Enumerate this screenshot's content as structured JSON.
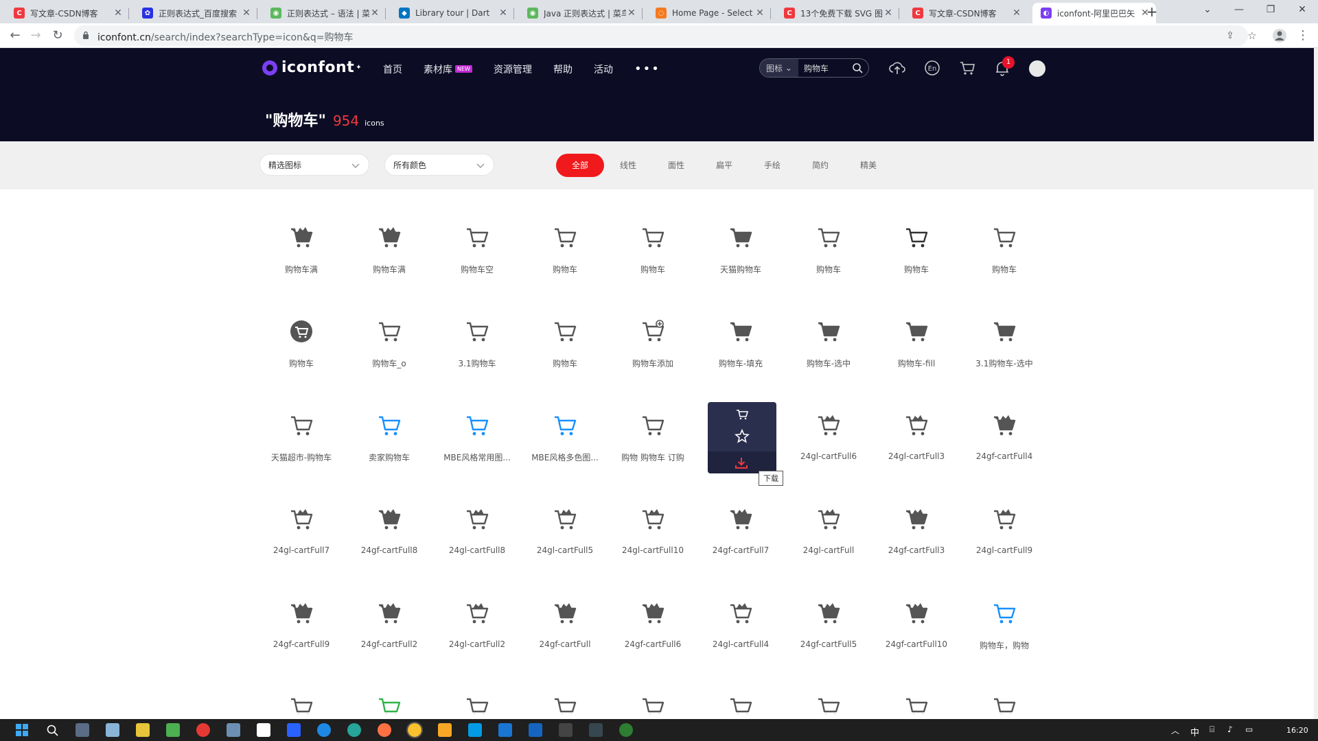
{
  "browser": {
    "tabs": [
      {
        "title": "写文章-CSDN博客",
        "color": "#f0383f",
        "glyph": "C"
      },
      {
        "title": "正则表达式_百度搜索",
        "color": "#2932e1",
        "glyph": "✿"
      },
      {
        "title": "正则表达式 – 语法 | 菜",
        "color": "#5cb85c",
        "glyph": "◉"
      },
      {
        "title": "Library tour | Dart",
        "color": "#0175c2",
        "glyph": "◆"
      },
      {
        "title": "Java 正则表达式 | 菜鸟",
        "color": "#5cb85c",
        "glyph": "◉"
      },
      {
        "title": "Home Page - Select",
        "color": "#f47a20",
        "glyph": "◌"
      },
      {
        "title": "13个免费下载 SVG 图",
        "color": "#f0383f",
        "glyph": "C"
      },
      {
        "title": "写文章-CSDN博客",
        "color": "#f0383f",
        "glyph": "C"
      },
      {
        "title": "iconfont-阿里巴巴矢",
        "color": "#7b3ff2",
        "glyph": "◐"
      }
    ],
    "url_host": "iconfont.cn",
    "url_path": "/search/index?searchType=icon&q=购物车"
  },
  "header": {
    "logo": "iconfont",
    "nav": [
      "首页",
      "素材库",
      "资源管理",
      "帮助",
      "活动"
    ],
    "new_badge": "NEW",
    "more": "•••",
    "search_type": "图标",
    "search_query": "购物车",
    "notif_count": "1",
    "result_query": "\"购物车\"",
    "result_count": "954",
    "result_unit": "icons"
  },
  "filters": {
    "select1": "精选图标",
    "select2": "所有颜色",
    "style_tabs": [
      "全部",
      "线性",
      "面性",
      "扁平",
      "手绘",
      "简约",
      "精美"
    ],
    "active_tab": "全部"
  },
  "icons": [
    "购物车满",
    "购物车满",
    "购物车空",
    "购物车",
    "购物车",
    "天猫购物车",
    "购物车",
    "购物车",
    "购物车",
    "购物车",
    "购物车_o",
    "3.1购物车",
    "购物车",
    "购物车添加",
    "购物车-填充",
    "购物车-选中",
    "购物车-fill",
    "3.1购物车-选中",
    "天猫超市-购物车",
    "卖家购物车",
    "MBE风格常用图...",
    "MBE风格多色图...",
    "购物 购物车 订购",
    "",
    "24gl-cartFull6",
    "24gl-cartFull3",
    "24gf-cartFull4",
    "24gl-cartFull7",
    "24gf-cartFull8",
    "24gl-cartFull8",
    "24gl-cartFull5",
    "24gl-cartFull10",
    "24gf-cartFull7",
    "24gl-cartFull",
    "24gf-cartFull3",
    "24gl-cartFull9",
    "24gf-cartFull9",
    "24gf-cartFull2",
    "24gl-cartFull2",
    "24gf-cartFull",
    "24gf-cartFull6",
    "24gl-cartFull4",
    "24gf-cartFull5",
    "24gf-cartFull10",
    "购物车，购物"
  ],
  "tooltip": "下载",
  "taskbar": {
    "ime": "中",
    "time": "16:20"
  },
  "colors": {
    "header_bg": "#0c0d24",
    "accent_red": "#f0191c",
    "icon_gray": "#555555",
    "icon_blue": "#1890ff"
  }
}
